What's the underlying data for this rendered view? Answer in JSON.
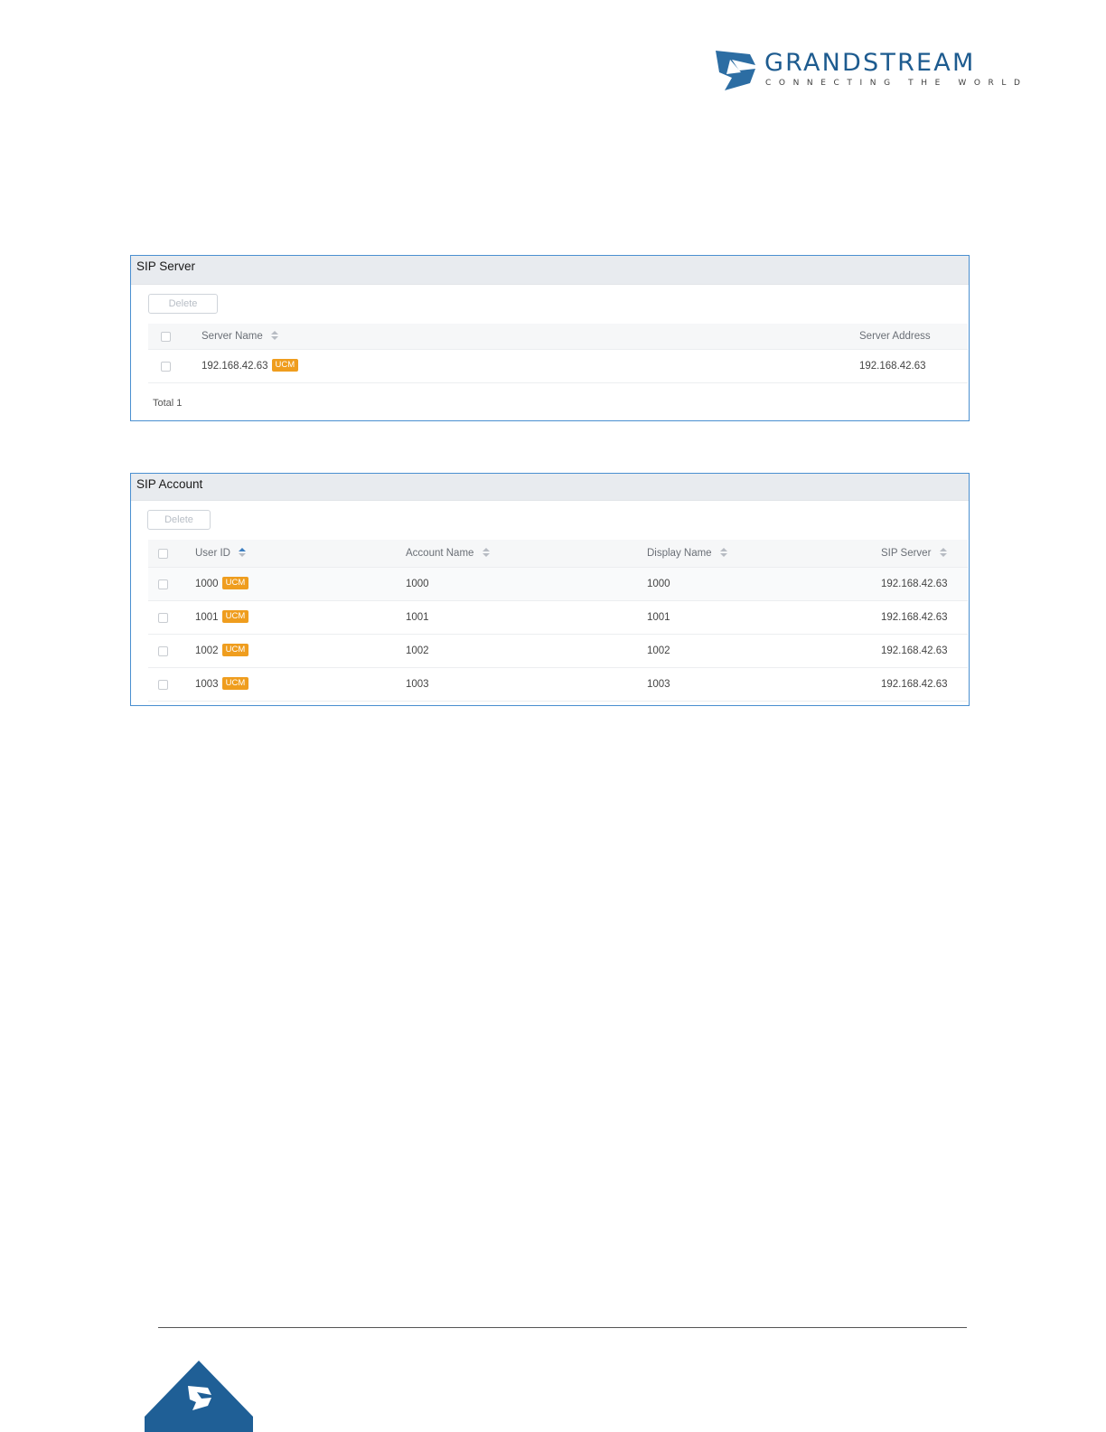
{
  "brand": {
    "name": "GRANDSTREAM",
    "tagline": "CONNECTING THE WORLD",
    "colors": {
      "primary": "#1d5b8f",
      "mark": "#2c6da3",
      "badge": "#ef9d1e",
      "panel_border": "#4a8fd0"
    }
  },
  "sip_server": {
    "title": "SIP Server",
    "delete_label": "Delete",
    "columns": {
      "name": "Server Name",
      "address": "Server Address"
    },
    "rows": [
      {
        "name": "192.168.42.63",
        "badge": "UCM",
        "address": "192.168.42.63"
      }
    ],
    "total": "Total 1"
  },
  "sip_account": {
    "title": "SIP Account",
    "delete_label": "Delete",
    "columns": {
      "user_id": "User ID",
      "account_name": "Account Name",
      "display_name": "Display Name",
      "sip_server": "SIP Server"
    },
    "rows": [
      {
        "user_id": "1000",
        "badge": "UCM",
        "account_name": "1000",
        "display_name": "1000",
        "sip_server": "192.168.42.63"
      },
      {
        "user_id": "1001",
        "badge": "UCM",
        "account_name": "1001",
        "display_name": "1001",
        "sip_server": "192.168.42.63"
      },
      {
        "user_id": "1002",
        "badge": "UCM",
        "account_name": "1002",
        "display_name": "1002",
        "sip_server": "192.168.42.63"
      },
      {
        "user_id": "1003",
        "badge": "UCM",
        "account_name": "1003",
        "display_name": "1003",
        "sip_server": "192.168.42.63"
      }
    ]
  },
  "icons": [
    "grandstream-logo-icon",
    "sort-icon",
    "checkbox-icon",
    "footer-logo-icon"
  ]
}
